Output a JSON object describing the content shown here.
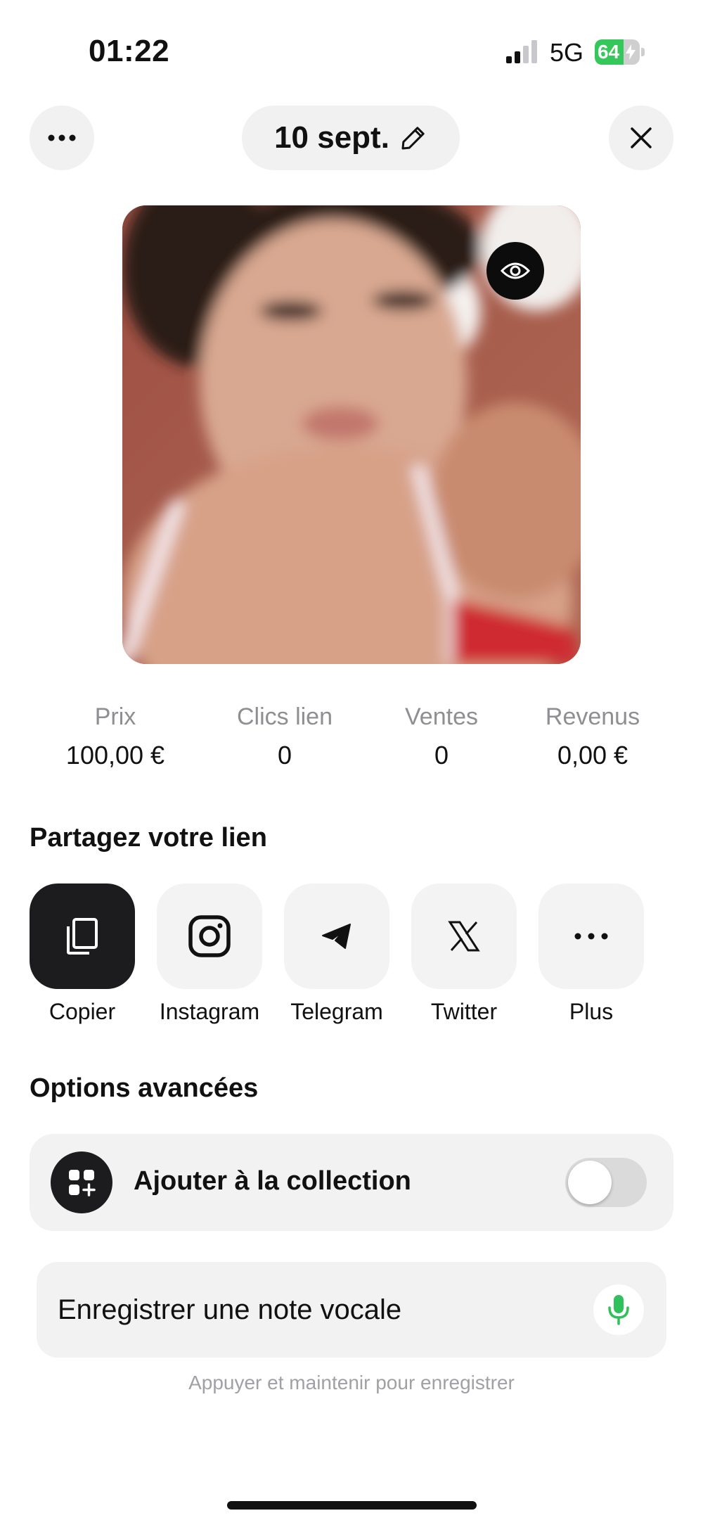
{
  "status_bar": {
    "time": "01:22",
    "network": "5G",
    "battery": "64",
    "battery_level": 0.64,
    "signal_icon": "cellular-signal-icon",
    "battery_icon": "battery-charging-icon"
  },
  "header": {
    "more_icon": "ellipsis-icon",
    "date_label": "10 sept.",
    "edit_icon": "pencil-icon",
    "close_icon": "close-icon"
  },
  "media": {
    "view_icon": "eye-icon"
  },
  "stats": [
    {
      "label": "Prix",
      "value": "100,00 €"
    },
    {
      "label": "Clics lien",
      "value": "0"
    },
    {
      "label": "Ventes",
      "value": "0"
    },
    {
      "label": "Revenus",
      "value": "0,00 €"
    }
  ],
  "share": {
    "title": "Partagez votre lien",
    "items": [
      {
        "label": "Copier",
        "icon": "copy-icon"
      },
      {
        "label": "Instagram",
        "icon": "instagram-icon"
      },
      {
        "label": "Telegram",
        "icon": "telegram-icon"
      },
      {
        "label": "Twitter",
        "icon": "x-twitter-icon"
      },
      {
        "label": "Plus",
        "icon": "ellipsis-icon"
      }
    ]
  },
  "options": {
    "title": "Options avancées",
    "collection": {
      "label": "Ajouter à la collection",
      "icon": "add-to-collection-icon",
      "enabled": false
    }
  },
  "voice_note": {
    "label": "Enregistrer une note vocale",
    "hint": "Appuyer et maintenir pour enregistrer",
    "icon": "microphone-icon",
    "accent": "#2fc15b"
  }
}
